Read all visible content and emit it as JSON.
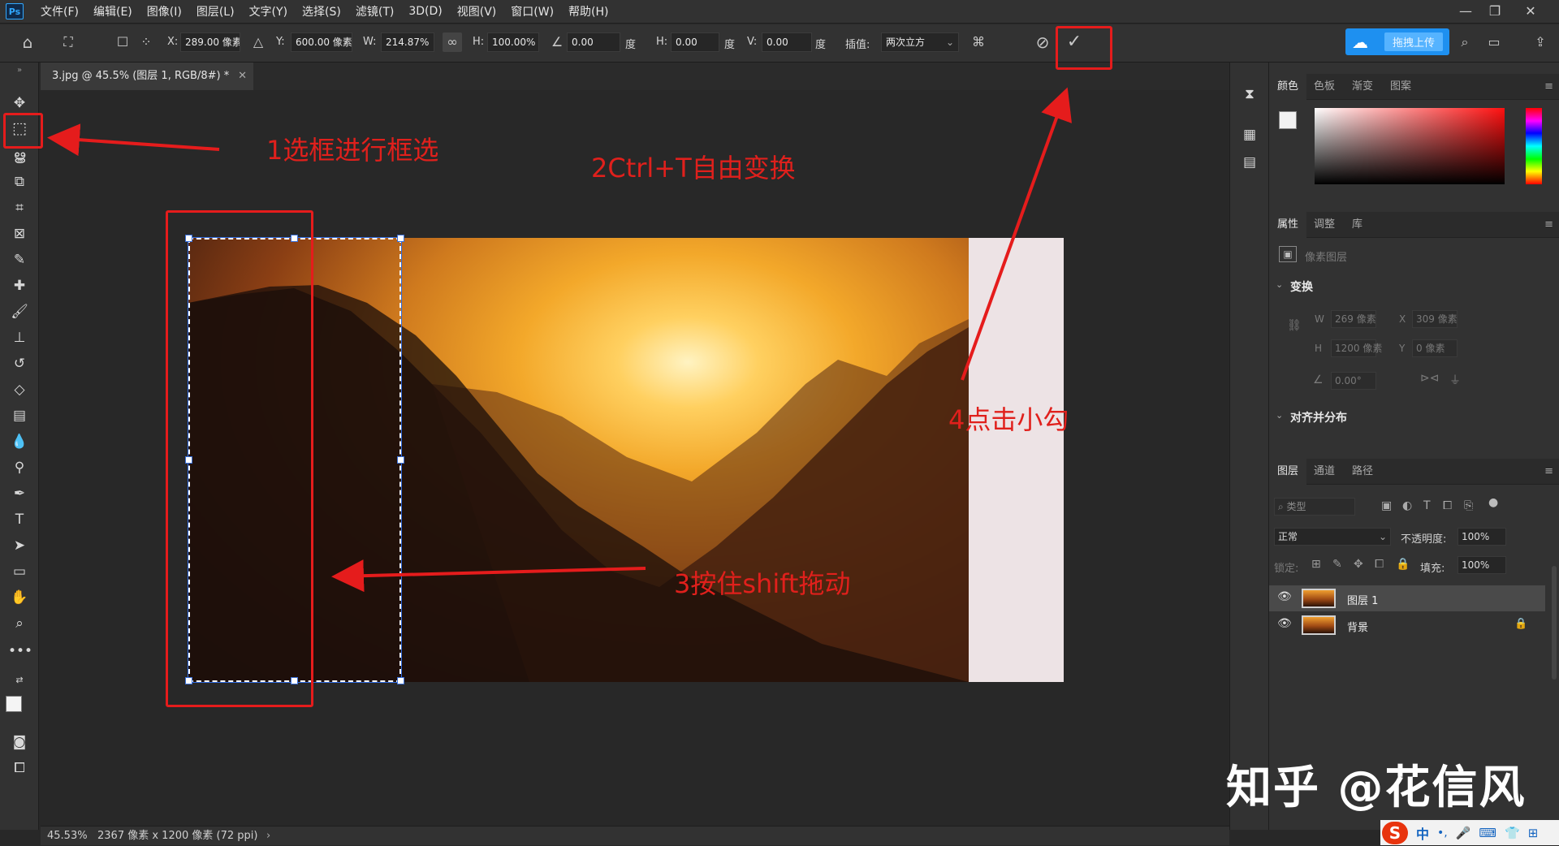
{
  "menubar": {
    "logo": "Ps",
    "items": [
      "文件(F)",
      "编辑(E)",
      "图像(I)",
      "图层(L)",
      "文字(Y)",
      "选择(S)",
      "滤镜(T)",
      "3D(D)",
      "视图(V)",
      "窗口(W)",
      "帮助(H)"
    ],
    "window_controls": [
      "—",
      "❐",
      "✕"
    ]
  },
  "options": {
    "x_label": "X:",
    "x_value": "289.00 像素",
    "y_label": "Y:",
    "y_value": "600.00 像素",
    "w_label": "W:",
    "w_value": "214.87%",
    "h_label": "H:",
    "h_value": "100.00%",
    "angle_value": "0.00",
    "angle_unit": "度",
    "hskew_label": "H:",
    "hskew_value": "0.00",
    "hskew_unit": "度",
    "vskew_label": "V:",
    "vskew_value": "0.00",
    "vskew_unit": "度",
    "interp_label": "插值:",
    "interp_value": "两次立方",
    "upload_label": "拖拽上传"
  },
  "document": {
    "tab_title": "3.jpg @ 45.5% (图层 1, RGB/8#) *"
  },
  "annotations": {
    "step1": "1选框进行框选",
    "step2": "2Ctrl+T自由变换",
    "step3": "3按住shift拖动",
    "step4": "4点击小勾"
  },
  "color_panel": {
    "tabs": [
      "颜色",
      "色板",
      "渐变",
      "图案"
    ]
  },
  "properties_panel": {
    "tabs": [
      "属性",
      "调整",
      "库"
    ],
    "layer_type": "像素图层",
    "transform_heading": "变换",
    "w_label": "W",
    "w_value": "269 像素",
    "x_label": "X",
    "x_value": "309 像素",
    "h_label": "H",
    "h_value": "1200 像素",
    "y_label": "Y",
    "y_value": "0 像素",
    "angle_value": "0.00°",
    "align_heading": "对齐并分布"
  },
  "layers_panel": {
    "tabs": [
      "图层",
      "通道",
      "路径"
    ],
    "filter_placeholder": "类型",
    "blend_mode": "正常",
    "opacity_label": "不透明度:",
    "opacity_value": "100%",
    "lock_label": "锁定:",
    "fill_label": "填充:",
    "fill_value": "100%",
    "layers": [
      {
        "name": "图层 1",
        "selected": true,
        "locked": false
      },
      {
        "name": "背景",
        "selected": false,
        "locked": true
      }
    ]
  },
  "statusbar": {
    "zoom": "45.53%",
    "doc_info": "2367 像素 x 1200 像素 (72 ppi)"
  },
  "watermark": "知乎 @花信风",
  "ime": {
    "label": "中"
  },
  "colors": {
    "accent": "#e51c1c",
    "upload": "#1e90f0"
  }
}
